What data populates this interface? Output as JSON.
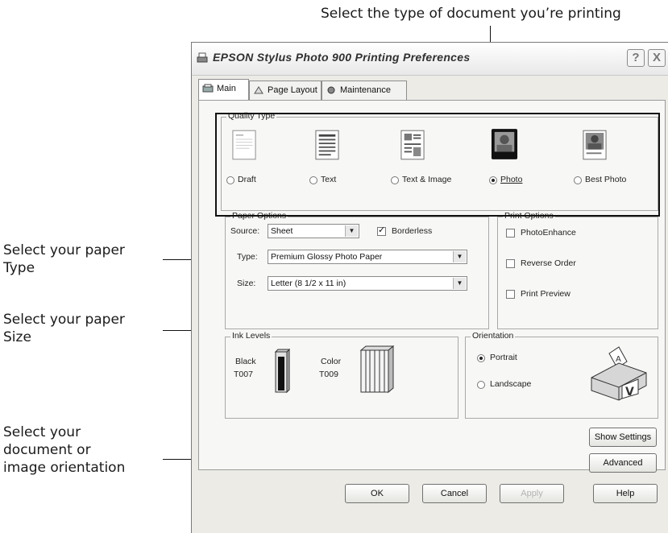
{
  "callouts": {
    "top": "Select the type of document you’re printing",
    "paper_type": [
      "Select your paper",
      "Type"
    ],
    "paper_size": [
      "Select your paper",
      "Size"
    ],
    "orientation": [
      "Select your",
      "document or",
      "image orientation"
    ]
  },
  "window": {
    "title": "EPSON Stylus Photo 900 Printing Preferences",
    "help_label": "?",
    "close_label": "X"
  },
  "tabs": [
    "Main",
    "Page Layout",
    "Maintenance"
  ],
  "quality_type": {
    "label": "Quality Type",
    "options": [
      "Draft",
      "Text",
      "Text & Image",
      "Photo",
      "Best Photo"
    ],
    "selected": "Photo"
  },
  "paper_options": {
    "label": "Paper Options",
    "source_label": "Source:",
    "source_value": "Sheet",
    "borderless_label": "Borderless",
    "borderless_checked": true,
    "type_label": "Type:",
    "type_value": "Premium Glossy Photo Paper",
    "size_label": "Size:",
    "size_value": "Letter (8 1/2 x 11 in)"
  },
  "print_options": {
    "label": "Print Options",
    "items": [
      "PhotoEnhance",
      "Reverse Order",
      "Print Preview"
    ]
  },
  "ink_levels": {
    "label": "Ink Levels",
    "black_label": "Black",
    "black_code": "T007",
    "color_label": "Color",
    "color_code": "T009"
  },
  "orientation": {
    "label": "Orientation",
    "options": [
      "Portrait",
      "Landscape"
    ],
    "selected": "Portrait"
  },
  "buttons": {
    "show_settings": "Show Settings",
    "advanced": "Advanced",
    "ok": "OK",
    "cancel": "Cancel",
    "apply": "Apply",
    "help": "Help"
  }
}
